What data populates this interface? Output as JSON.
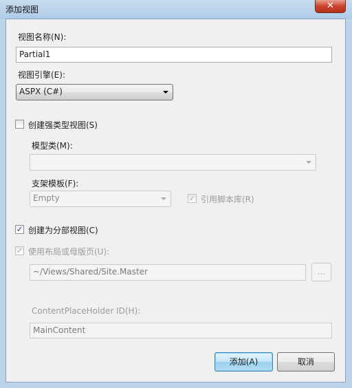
{
  "window": {
    "title": "添加视图",
    "close_icon": "close-icon"
  },
  "view_name": {
    "label": "视图名称(N):",
    "value": "Partial1"
  },
  "view_engine": {
    "label": "视图引擎(E):",
    "value": "ASPX (C#)"
  },
  "strongly_typed": {
    "label": "创建强类型视图(S)",
    "checked": false
  },
  "model_class": {
    "label": "模型类(M):",
    "value": ""
  },
  "scaffold_template": {
    "label": "支架模板(F):",
    "value": "Empty"
  },
  "reference_scripts": {
    "label": "引用脚本库(R)",
    "checked": true,
    "enabled": false
  },
  "partial_view": {
    "label": "创建为分部视图(C)",
    "checked": true
  },
  "use_layout": {
    "label": "使用布局或母版页(U):",
    "checked": true,
    "enabled": false,
    "value": "~/Views/Shared/Site.Master",
    "browse_label": "..."
  },
  "content_placeholder": {
    "label": "ContentPlaceHolder ID(H):",
    "value": "MainContent"
  },
  "buttons": {
    "add": "添加(A)",
    "cancel": "取消"
  }
}
